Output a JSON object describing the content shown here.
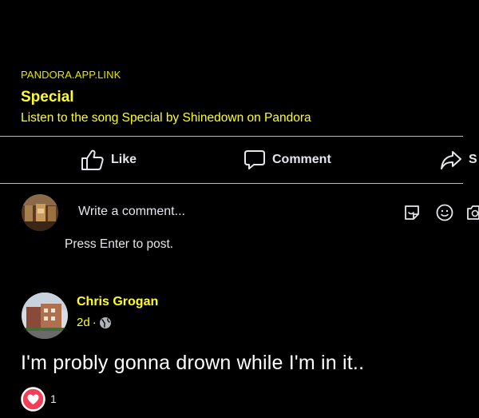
{
  "link_preview": {
    "domain": "PANDORA.APP.LINK",
    "title": "Special",
    "description": "Listen to the song Special by Shinedown on Pandora"
  },
  "actions": {
    "like_label": "Like",
    "comment_label": "Comment",
    "share_label": "S"
  },
  "composer": {
    "placeholder": "Write a comment...",
    "hint": "Press Enter to post."
  },
  "comment": {
    "author": "Chris Grogan",
    "time": "2d",
    "separator": "·",
    "text": "I'm probly gonna drown while I'm in it..",
    "reaction_count": "1"
  },
  "colors": {
    "background": "#000000",
    "accent_yellow": "#ffff1e",
    "text": "#e4e6eb",
    "divider": "#b9bbbe",
    "love_reaction": "#f33e58"
  },
  "icons": {
    "like": "thumbs-up-icon",
    "comment": "speech-bubble-icon",
    "share": "share-arrow-icon",
    "sticker": "sticker-icon",
    "emoji": "smiley-icon",
    "camera": "camera-icon",
    "audience": "globe-icon",
    "reaction": "heart-reaction-icon"
  }
}
